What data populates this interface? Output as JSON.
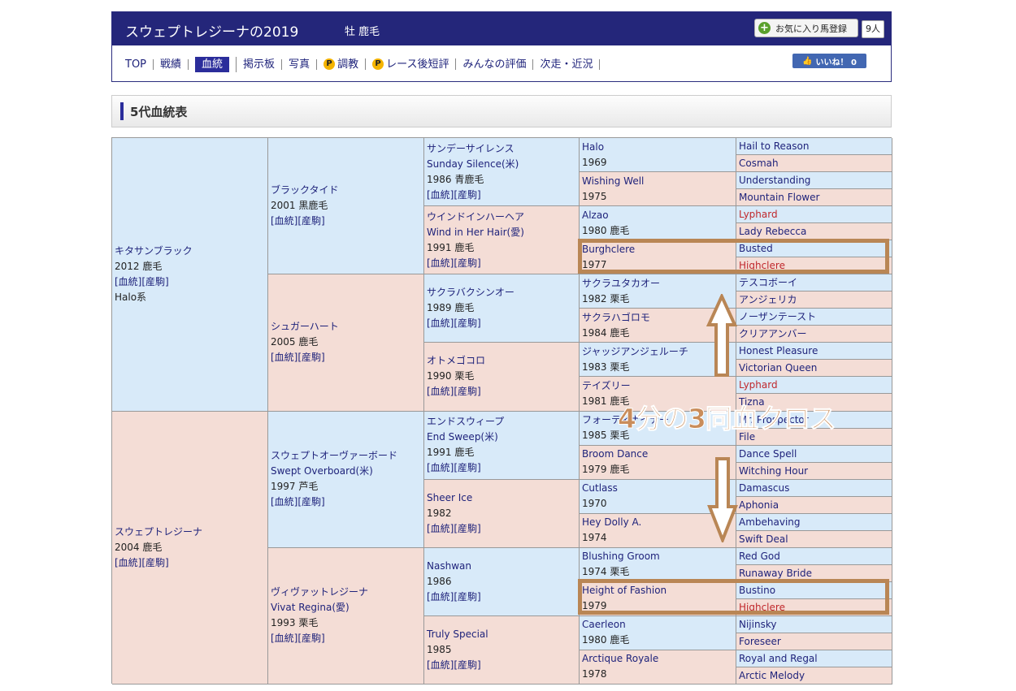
{
  "header": {
    "horse_name": "スウェプトレジーナの2019",
    "sex_color": "牡 鹿毛",
    "fav_label": "お気に入り馬登録",
    "fav_count": "9人",
    "like_label": "いいね！ 0",
    "nav": [
      {
        "label": "TOP",
        "active": false,
        "p": false
      },
      {
        "label": "戦績",
        "active": false,
        "p": false
      },
      {
        "label": "血統",
        "active": true,
        "p": false
      },
      {
        "label": "掲示板",
        "active": false,
        "p": false
      },
      {
        "label": "写真",
        "active": false,
        "p": false
      },
      {
        "label": "調教",
        "active": false,
        "p": true
      },
      {
        "label": "レース後短評",
        "active": false,
        "p": true
      },
      {
        "label": "みんなの評価",
        "active": false,
        "p": false
      },
      {
        "label": "次走・近況",
        "active": false,
        "p": false
      }
    ]
  },
  "section_title": "5代血統表",
  "pedigree": {
    "sire": {
      "jp": "キタサンブラック",
      "info": "2012 鹿毛",
      "links": "[血統][産駒]",
      "line": "Halo系"
    },
    "dam": {
      "jp": "スウェプトレジーナ",
      "info": "2004 鹿毛",
      "links": "[血統][産駒]"
    },
    "gen2": [
      {
        "jp": "ブラックタイド",
        "info": "2001 黒鹿毛",
        "links": "[血統][産駒]"
      },
      {
        "jp": "シュガーハート",
        "info": "2005 鹿毛",
        "links": "[血統][産駒]"
      },
      {
        "jp": "スウェプトオーヴァーボード",
        "en": "Swept Overboard(米)",
        "info": "1997 芦毛",
        "links": "[血統][産駒]"
      },
      {
        "jp": "ヴィヴァットレジーナ",
        "en": "Vivat Regina(愛)",
        "info": "1993 栗毛",
        "links": "[血統][産駒]"
      }
    ],
    "gen3": [
      {
        "jp": "サンデーサイレンス",
        "en": "Sunday Silence(米)",
        "info": "1986 青鹿毛",
        "links": "[血統][産駒]"
      },
      {
        "jp": "ウインドインハーヘア",
        "en": "Wind in Her Hair(愛)",
        "info": "1991 鹿毛",
        "links": "[血統][産駒]"
      },
      {
        "jp": "サクラバクシンオー",
        "info": "1989 鹿毛",
        "links": "[血統][産駒]"
      },
      {
        "jp": "オトメゴコロ",
        "info": "1990 栗毛",
        "links": "[血統][産駒]"
      },
      {
        "jp": "エンドスウィープ",
        "en": "End Sweep(米)",
        "info": "1991 鹿毛",
        "links": "[血統][産駒]"
      },
      {
        "jp": "Sheer Ice",
        "info": "1982",
        "links": "[血統][産駒]"
      },
      {
        "jp": "Nashwan",
        "info": "1986",
        "links": "[血統][産駒]"
      },
      {
        "jp": "Truly Special",
        "info": "1985",
        "links": "[血統][産駒]"
      }
    ],
    "gen4": [
      {
        "name": "Halo",
        "info": "1969"
      },
      {
        "name": "Wishing Well",
        "info": "1975"
      },
      {
        "name": "Alzao",
        "info": "1980 鹿毛"
      },
      {
        "name": "Burghclere",
        "info": "1977"
      },
      {
        "name": "サクラユタカオー",
        "info": "1982 栗毛"
      },
      {
        "name": "サクラハゴロモ",
        "info": "1984 鹿毛"
      },
      {
        "name": "ジャッジアンジェルーチ",
        "info": "1983 栗毛"
      },
      {
        "name": "テイズリー",
        "info": "1981 鹿毛"
      },
      {
        "name": "フォーティナイナー",
        "info": "1985 栗毛"
      },
      {
        "name": "Broom Dance",
        "info": "1979 鹿毛"
      },
      {
        "name": "Cutlass",
        "info": "1970"
      },
      {
        "name": "Hey Dolly A.",
        "info": "1974"
      },
      {
        "name": "Blushing Groom",
        "info": "1974 栗毛"
      },
      {
        "name": "Height of Fashion",
        "info": "1979"
      },
      {
        "name": "Caerleon",
        "info": "1980 鹿毛"
      },
      {
        "name": "Arctique Royale",
        "info": "1978"
      }
    ],
    "gen5": [
      {
        "name": "Hail to Reason",
        "red": false
      },
      {
        "name": "Cosmah",
        "red": false
      },
      {
        "name": "Understanding",
        "red": false
      },
      {
        "name": "Mountain Flower",
        "red": false
      },
      {
        "name": "Lyphard",
        "red": true
      },
      {
        "name": "Lady Rebecca",
        "red": false
      },
      {
        "name": "Busted",
        "red": false
      },
      {
        "name": "Highclere",
        "red": true
      },
      {
        "name": "テスコボーイ",
        "red": false
      },
      {
        "name": "アンジェリカ",
        "red": false
      },
      {
        "name": "ノーザンテースト",
        "red": false
      },
      {
        "name": "クリアアンバー",
        "red": false
      },
      {
        "name": "Honest Pleasure",
        "red": false
      },
      {
        "name": "Victorian Queen",
        "red": false
      },
      {
        "name": "Lyphard",
        "red": true
      },
      {
        "name": "Tizna",
        "red": false
      },
      {
        "name": "Mr. Prospector",
        "red": false
      },
      {
        "name": "File",
        "red": false
      },
      {
        "name": "Dance Spell",
        "red": false
      },
      {
        "name": "Witching Hour",
        "red": false
      },
      {
        "name": "Damascus",
        "red": false
      },
      {
        "name": "Aphonia",
        "red": false
      },
      {
        "name": "Ambehaving",
        "red": false
      },
      {
        "name": "Swift Deal",
        "red": false
      },
      {
        "name": "Red God",
        "red": false
      },
      {
        "name": "Runaway Bride",
        "red": false
      },
      {
        "name": "Bustino",
        "red": false
      },
      {
        "name": "Highclere",
        "red": true
      },
      {
        "name": "Nijinsky",
        "red": false
      },
      {
        "name": "Foreseer",
        "red": false
      },
      {
        "name": "Royal and Regal",
        "red": false
      },
      {
        "name": "Arctic Melody",
        "red": false
      }
    ]
  },
  "annotation": {
    "label": "4分の3同血クロス",
    "color": "#c98d5b"
  }
}
